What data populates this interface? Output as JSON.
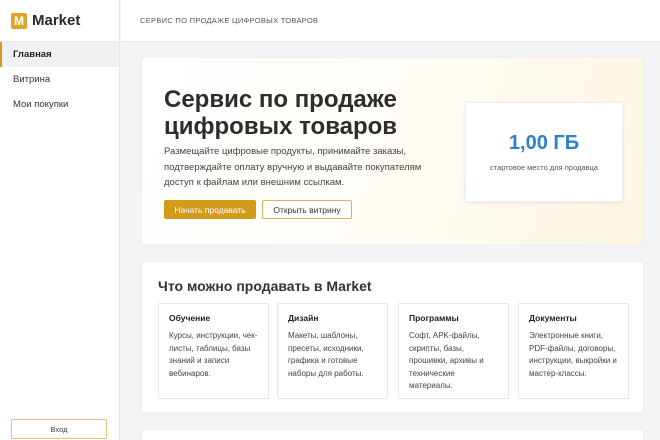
{
  "sidebar": {
    "logo_letter": "M",
    "brand": "Market",
    "items": [
      {
        "label": "Главная",
        "active": true
      },
      {
        "label": "Витрина",
        "active": false
      },
      {
        "label": "Мои покупки",
        "active": false
      }
    ],
    "login_label": "Вход"
  },
  "header": {
    "breadcrumb": "СЕРВИС ПО ПРОДАЖЕ ЦИФРОВЫХ ТОВАРОВ"
  },
  "hero": {
    "title": "Сервис по продаже цифровых товаров",
    "description": "Размещайте цифровые продукты, принимайте заказы, подтверждайте оплату вручную и выдавайте покупателям доступ к файлам или внешним ссылкам.",
    "primary_button": "Начать продавать",
    "secondary_button": "Открыть витрину",
    "stat_value": "1,00 ГБ",
    "stat_label": "стартовое место для продавца"
  },
  "sell": {
    "title": "Что можно продавать в Market",
    "categories": [
      {
        "title": "Обучение",
        "text": "Курсы, инструкции, чек-листы, таблицы, базы знаний и записи вебинаров."
      },
      {
        "title": "Дизайн",
        "text": "Макеты, шаблоны, пресеты, исходники, графика и готовые наборы для работы."
      },
      {
        "title": "Программы",
        "text": "Софт, APK-файлы, скрипты, базы, прошивки, архивы и технические материалы."
      },
      {
        "title": "Документы",
        "text": "Электронные книги, PDF-файлы, договоры, инструкции, выкройки и мастер-классы."
      }
    ]
  },
  "colors": {
    "accent": "#d39a1c",
    "stat": "#2f80c8"
  }
}
